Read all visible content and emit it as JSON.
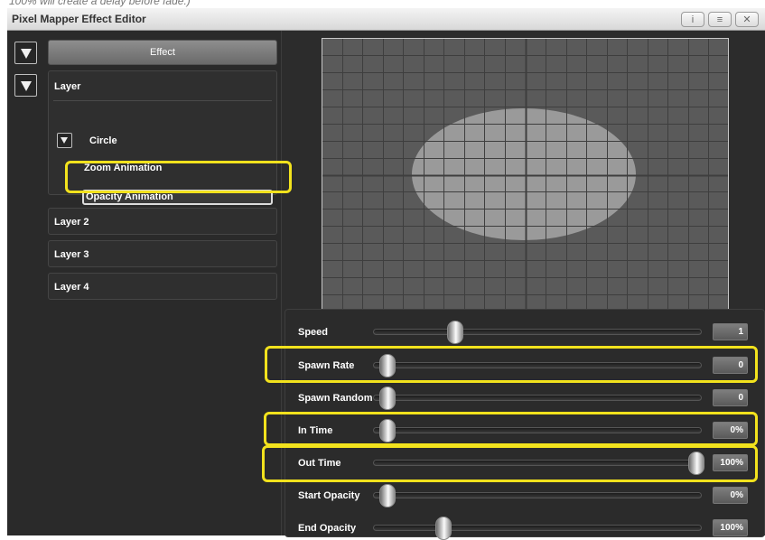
{
  "caption": "100% will create a delay before fade.)",
  "window": {
    "title": "Pixel Mapper Effect Editor",
    "buttons": [
      {
        "icon": "info-icon",
        "glyph": "i"
      },
      {
        "icon": "menu-icon",
        "glyph": "≡"
      },
      {
        "icon": "close-icon",
        "glyph": "✕"
      }
    ]
  },
  "sidebar": {
    "effect_label": "Effect",
    "layer": {
      "label": "Layer",
      "shape_label": "Circle",
      "animations": [
        "Zoom Animation",
        "Opacity Animation"
      ],
      "selected_animation": "Opacity Animation"
    },
    "other_layers": [
      "Layer 2",
      "Layer 3",
      "Layer 4"
    ]
  },
  "preview": {
    "grid": {
      "columns": 20,
      "rows": 16
    },
    "colors": {
      "background": "#5a5a5a",
      "grid_line": "#3e3e3e",
      "frame": "#c8c8c8",
      "shape": "#9a9a9a"
    }
  },
  "params": [
    {
      "label": "Speed",
      "value": "1",
      "position": 0.22
    },
    {
      "label": "Spawn Rate",
      "value": "0",
      "position": 0.0
    },
    {
      "label": "Spawn Random",
      "value": "0",
      "position": 0.0
    },
    {
      "label": "In Time",
      "value": "0%",
      "position": 0.0
    },
    {
      "label": "Out Time",
      "value": "100%",
      "position": 1.0
    },
    {
      "label": "Start Opacity",
      "value": "0%",
      "position": 0.0
    },
    {
      "label": "End Opacity",
      "value": "100%",
      "position": 0.18
    }
  ],
  "highlight_color": "#f2e21d"
}
